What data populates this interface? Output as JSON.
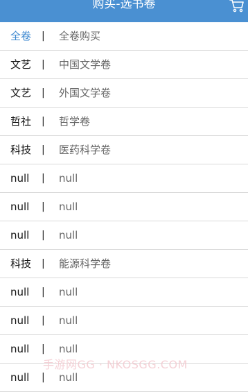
{
  "header": {
    "title": "购买-选书卷",
    "cart_icon": "cart-icon",
    "background": "#4a90d2"
  },
  "list": {
    "separator": "|",
    "accent": "#3a86cf",
    "items": [
      {
        "category": "全卷",
        "name": "全卷购买"
      },
      {
        "category": "文艺",
        "name": "中国文学卷"
      },
      {
        "category": "文艺",
        "name": "外国文学卷"
      },
      {
        "category": "哲社",
        "name": "哲学卷"
      },
      {
        "category": "科技",
        "name": "医药科学卷"
      },
      {
        "category": "null",
        "name": "null"
      },
      {
        "category": "null",
        "name": "null"
      },
      {
        "category": "null",
        "name": "null"
      },
      {
        "category": "科技",
        "name": "能源科学卷"
      },
      {
        "category": "null",
        "name": "null"
      },
      {
        "category": "null",
        "name": "null"
      },
      {
        "category": "null",
        "name": "null"
      },
      {
        "category": "null",
        "name": "null"
      }
    ]
  },
  "watermark": "手游网GG · NKOSGG.COM"
}
